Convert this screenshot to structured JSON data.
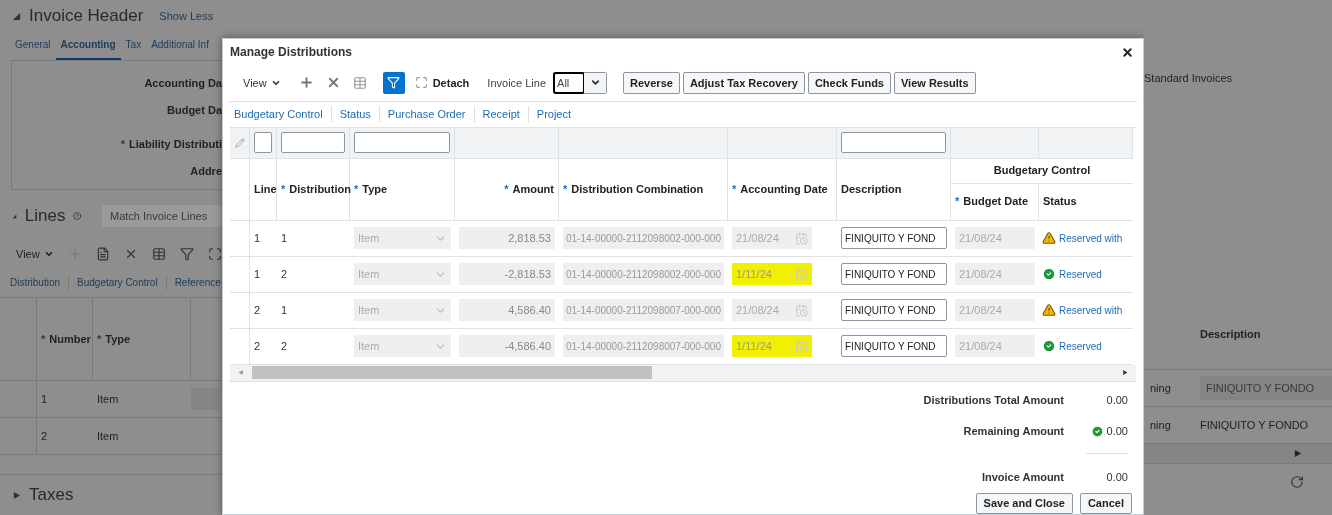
{
  "background_page": {
    "header_title": "Invoice Header",
    "show_less": "Show Less",
    "tabs": [
      {
        "label": "General",
        "selected": false
      },
      {
        "label": "Accounting",
        "selected": true
      },
      {
        "label": "Tax",
        "selected": false
      },
      {
        "label": "Additional Inf",
        "selected": false
      }
    ],
    "fields": [
      {
        "label": "Accounting Da"
      },
      {
        "label": "Budget Da"
      },
      {
        "label": "Liability Distributi",
        "mark": "*"
      },
      {
        "label": "Addre"
      }
    ],
    "right_text": "Standard Invoices",
    "lines_title": "Lines",
    "match_placeholder": "Match Invoice Lines",
    "view_menu": "View",
    "line_tabs": [
      "Distribution",
      "Budgetary Control",
      "Reference"
    ],
    "columns": [
      {
        "label": "Number",
        "mark": "*"
      },
      {
        "label": "Type",
        "mark": "*"
      }
    ],
    "description_header": "Description",
    "rows": [
      {
        "number": "1",
        "type": "Item",
        "column_3": "ning",
        "description": "FINIQUITO Y FONDO",
        "kind": "field"
      },
      {
        "number": "2",
        "type": "Item",
        "column_3": "ning",
        "description": "FINIQUITO Y FONDO",
        "kind": "text"
      }
    ],
    "taxes_title": "Taxes"
  },
  "dialog": {
    "title": "Manage Distributions",
    "view_menu": "View",
    "detach": "Detach",
    "filter_on": true,
    "invoice_line_label": "Invoice Line",
    "invoice_line_value": "All",
    "buttons": [
      "Reverse",
      "Adjust Tax Recovery",
      "Check Funds",
      "View Results"
    ],
    "links": [
      "Budgetary Control",
      "Status",
      "Purchase Order",
      "Receipt",
      "Project"
    ],
    "columns": [
      {
        "label": "Line"
      },
      {
        "label": "Distribution",
        "mark": "*"
      },
      {
        "label": "Type",
        "mark": "*"
      },
      {
        "label": "Amount",
        "mark": "*"
      },
      {
        "label": "Distribution Combination",
        "mark": "*"
      },
      {
        "label": "Accounting Date",
        "mark": "*"
      },
      {
        "label": "Description"
      }
    ],
    "group_header": "Budgetary Control",
    "group_columns": [
      {
        "label": "Budget Date",
        "mark": "*"
      },
      {
        "label": "Status"
      }
    ],
    "rows": [
      {
        "line": "1",
        "distribution": "1",
        "type": "Item",
        "amount": "2,818.53",
        "combination": "01-14-00000-2112098002-000-000",
        "accounting_date": "21/08/24",
        "highlighted": false,
        "description": "FINIQUITO Y FOND",
        "budget_date": "21/08/24",
        "status": "Reserved with",
        "warning": true
      },
      {
        "line": "1",
        "distribution": "2",
        "type": "Item",
        "amount": "-2,818.53",
        "combination": "01-14-00000-2112098002-000-000",
        "accounting_date": "1/11/24",
        "highlighted": true,
        "description": "FINIQUITO Y FOND",
        "budget_date": "21/08/24",
        "status": "Reserved",
        "warning": false
      },
      {
        "line": "2",
        "distribution": "1",
        "type": "Item",
        "amount": "4,586.40",
        "combination": "01-14-00000-2112098007-000-000",
        "accounting_date": "21/08/24",
        "highlighted": false,
        "description": "FINIQUITO Y FOND",
        "budget_date": "21/08/24",
        "status": "Reserved with",
        "warning": true
      },
      {
        "line": "2",
        "distribution": "2",
        "type": "Item",
        "amount": "-4,586.40",
        "combination": "01-14-00000-2112098007-000-000",
        "accounting_date": "1/11/24",
        "highlighted": true,
        "description": "FINIQUITO Y FOND",
        "budget_date": "21/08/24",
        "status": "Reserved",
        "warning": false
      }
    ],
    "totals": [
      {
        "label": "Distributions Total Amount",
        "value": "0.00",
        "ok": false
      },
      {
        "label": "Remaining Amount",
        "value": "0.00",
        "ok": true
      },
      {
        "label": "Invoice Amount",
        "value": "0.00",
        "ok": false
      }
    ],
    "footer_buttons": [
      "Save and Close",
      "Cancel"
    ]
  }
}
